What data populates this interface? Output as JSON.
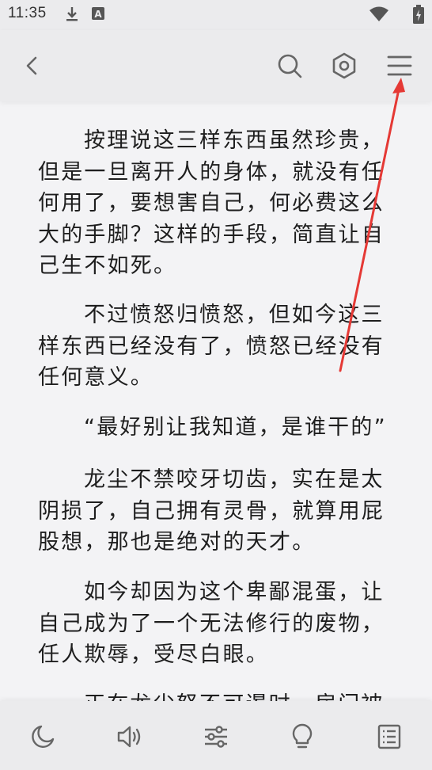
{
  "status_bar": {
    "time": "11:35",
    "icons": [
      "download-icon",
      "a-notification-icon",
      "wifi-icon",
      "battery-charging-icon"
    ]
  },
  "top_bar": {
    "icons": [
      "back-arrow-icon",
      "search-icon",
      "settings-hexagon-icon",
      "menu-icon"
    ]
  },
  "content": {
    "paragraphs": [
      "按理说这三样东西虽然珍贵，但是一旦离开人的身体，就没有任何用了，要想害自己，何必费这么大的手脚？这样的手段，简直让自己生不如死。",
      "不过愤怒归愤怒，但如今这三样东西已经没有了，愤怒已经没有任何意义。",
      "“最好别让我知道，是谁干的”",
      "龙尘不禁咬牙切齿，实在是太阴损了，自己拥有灵骨，就算用屁股想，那也是绝对的天才。",
      "如今却因为这个卑鄙混蛋，让自己成为了一个无法修行的废物，任人欺辱，受尽白眼。",
      "正在龙尘怒不可遏时，房门被"
    ]
  },
  "bottom_bar": {
    "icons": [
      "night-mode-moon-icon",
      "speaker-volume-icon",
      "sliders-adjust-icon",
      "lightbulb-icon",
      "table-of-contents-icon"
    ]
  },
  "annotation": {
    "color": "#e53935"
  }
}
